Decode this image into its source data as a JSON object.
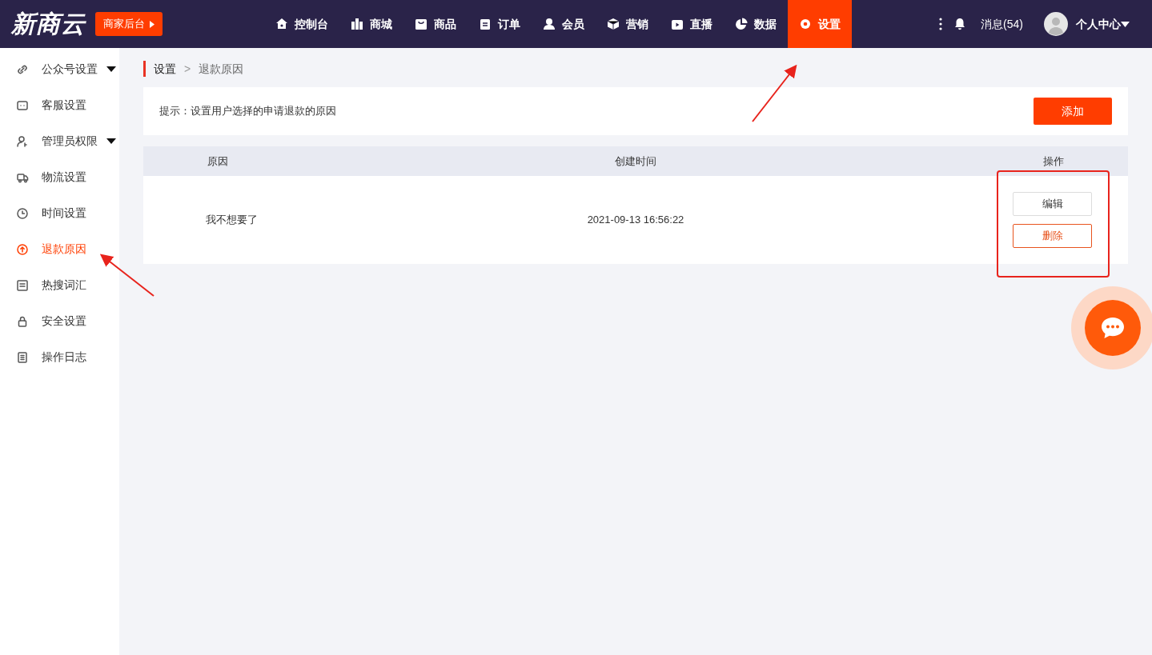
{
  "header": {
    "logo": "新商云",
    "backend_button": "商家后台",
    "nav": [
      {
        "label": "控制台",
        "selected": false
      },
      {
        "label": "商城",
        "selected": false
      },
      {
        "label": "商品",
        "selected": false
      },
      {
        "label": "订单",
        "selected": false
      },
      {
        "label": "会员",
        "selected": false
      },
      {
        "label": "营销",
        "selected": false
      },
      {
        "label": "直播",
        "selected": false
      },
      {
        "label": "数据",
        "selected": false
      },
      {
        "label": "设置",
        "selected": true
      }
    ],
    "messages": "消息(54)",
    "user": "个人中心"
  },
  "sidebar": {
    "items": [
      {
        "label": "公众号设置",
        "kind": "group",
        "selected": false
      },
      {
        "label": "客服设置",
        "kind": "link",
        "selected": false
      },
      {
        "label": "管理员权限",
        "kind": "group",
        "selected": false
      },
      {
        "label": "物流设置",
        "kind": "link",
        "selected": false
      },
      {
        "label": "时间设置",
        "kind": "link",
        "selected": false
      },
      {
        "label": "退款原因",
        "kind": "link",
        "selected": true
      },
      {
        "label": "热搜词汇",
        "kind": "link",
        "selected": false
      },
      {
        "label": "安全设置",
        "kind": "link",
        "selected": false
      },
      {
        "label": "操作日志",
        "kind": "link",
        "selected": false
      }
    ]
  },
  "breadcrumb": [
    "设置",
    "退款原因"
  ],
  "breadcrumb_separator": ">",
  "tip": "提示：设置用户选择的申请退款的原因",
  "add_button": "添加",
  "table": {
    "columns": [
      "原因",
      "创建时间",
      "操作"
    ],
    "rows": [
      {
        "reason": "我不想要了",
        "created": "2021-09-13 16:56:22",
        "actions": [
          "编辑",
          "删除"
        ]
      }
    ]
  }
}
